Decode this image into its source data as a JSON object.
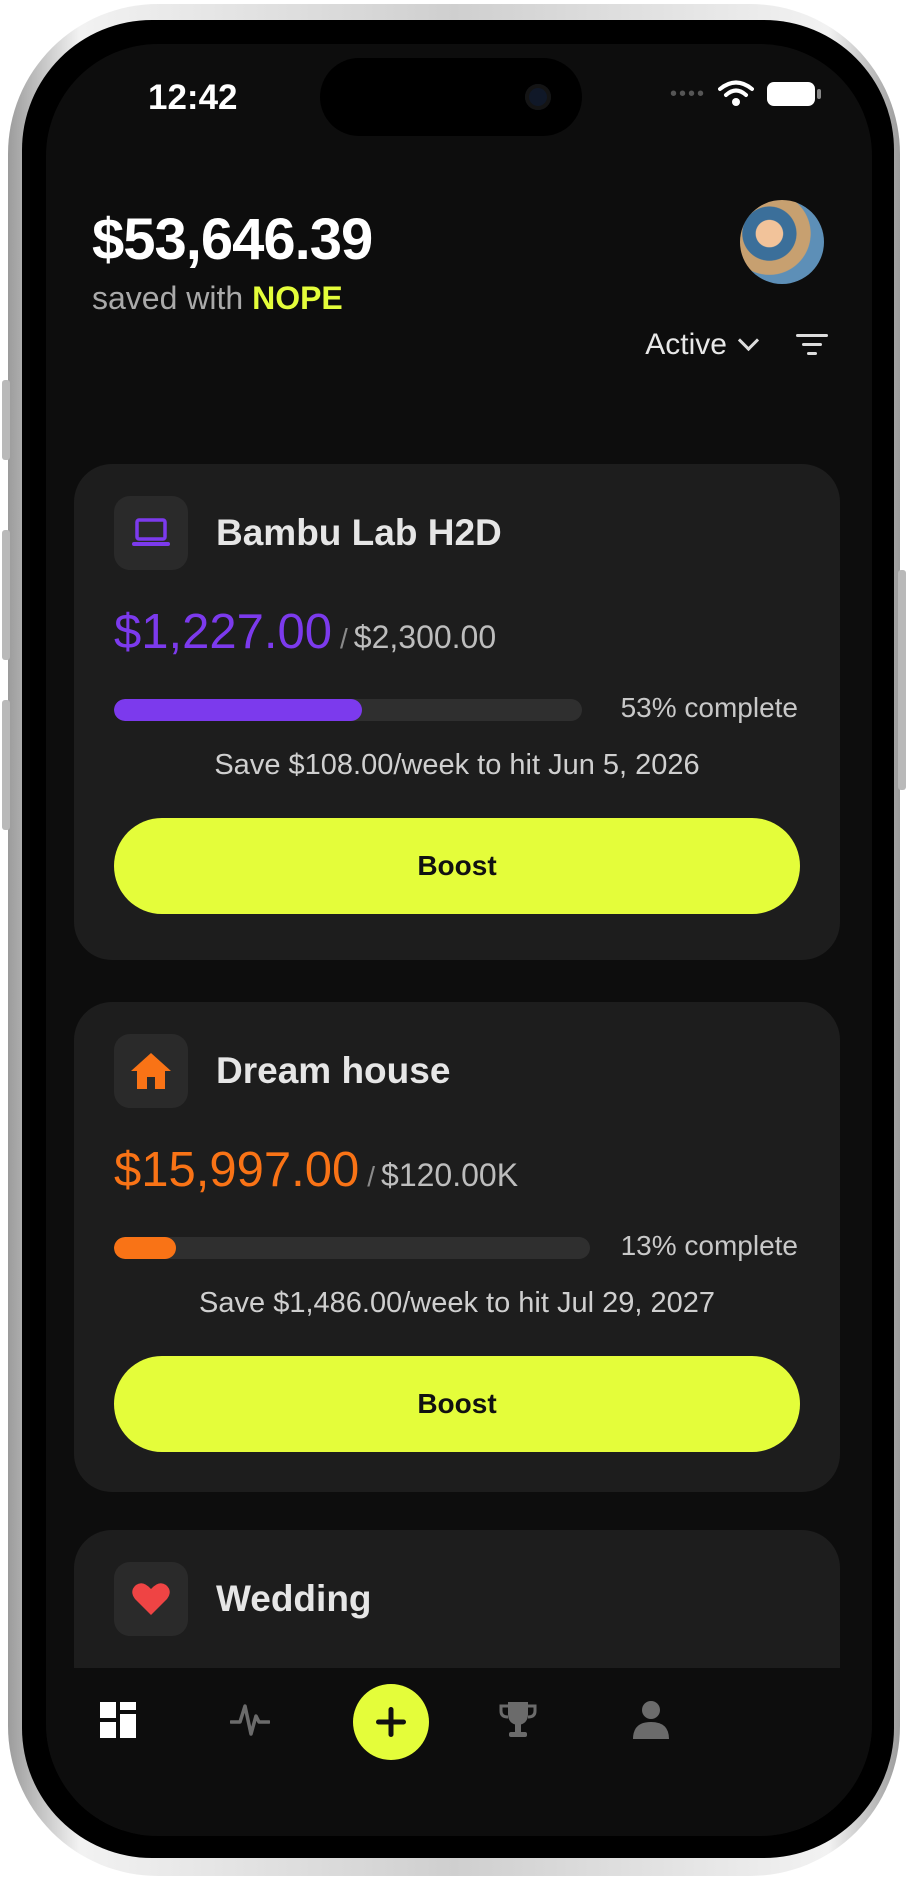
{
  "status_bar": {
    "time": "12:42"
  },
  "header": {
    "balance": "$53,646.39",
    "saved_prefix": "saved with ",
    "brand": "NOPE"
  },
  "filters": {
    "status_selected": "Active"
  },
  "goals": [
    {
      "name": "Bambu Lab H2D",
      "icon": "laptop-icon",
      "accent": "#7c3aed",
      "saved": "$1,227.00",
      "target": "$2,300.00",
      "progress": 0.53,
      "progress_label": "53% complete",
      "weekly": "Save $108.00/week to hit Jun 5, 2026",
      "button": "Boost"
    },
    {
      "name": "Dream house",
      "icon": "house-icon",
      "accent": "#f97316",
      "saved": "$15,997.00",
      "target": "$120.00K",
      "progress": 0.13,
      "progress_label": "13% complete",
      "weekly": "Save $1,486.00/week to hit Jul 29, 2027",
      "button": "Boost"
    },
    {
      "name": "Wedding",
      "icon": "heart-icon",
      "accent": "#ef4444"
    }
  ],
  "tab_bar": {
    "tabs": [
      "dashboard-icon",
      "activity-icon",
      "add-icon",
      "trophy-icon",
      "profile-icon"
    ],
    "accent": "#e4fd3a"
  }
}
